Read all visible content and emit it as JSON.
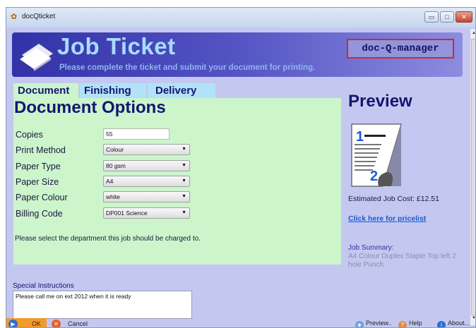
{
  "window": {
    "title": "docQticket",
    "controls": {
      "minimize": "▭",
      "maximize": "□",
      "close": "✕"
    }
  },
  "banner": {
    "title": "Job Ticket",
    "subtitle": "Please complete the ticket and submit your document for printing.",
    "brand": "doc-Q-manager"
  },
  "tabs": [
    {
      "label": "Document"
    },
    {
      "label": "Finishing"
    },
    {
      "label": "Delivery"
    }
  ],
  "form": {
    "title": "Document Options",
    "copies": {
      "label": "Copies",
      "value": "55"
    },
    "print_method": {
      "label": "Print Method",
      "value": "Colour"
    },
    "paper_type": {
      "label": "Paper Type",
      "value": "80 gsm"
    },
    "paper_size": {
      "label": "Paper Size",
      "value": "A4"
    },
    "paper_colour": {
      "label": "Paper Colour",
      "value": "white"
    },
    "billing_code": {
      "label": "Billing Code",
      "value": "DP001 Science"
    },
    "hint": "Please select the department this job should be charged to."
  },
  "preview": {
    "title": "Preview",
    "cost": "Estimated Job Cost: £12.51",
    "pricelist_link": "Click here for pricelist",
    "summary_label": "Job Summary:",
    "summary_text": "A4 Colour Duplex Staple Top left 2 hole Punch"
  },
  "special": {
    "label": "Special Instructions",
    "value": "Please call me on  ext 2012 when it is ready"
  },
  "footer": {
    "ok": "OK",
    "cancel": "Cancel",
    "preview": "Preview..",
    "help": "Help",
    "about": "About..."
  },
  "colors": {
    "window_bg": "#c4c8f0",
    "banner": "#3a3ab0",
    "panel_bg": "#ccf5cc",
    "heading": "#151570",
    "brand_border": "#c23030",
    "ok_button": "#f29a2e"
  },
  "icons": {
    "app": "app-icon",
    "banner": "paper-stack-icon",
    "preview": "document-preview-icon",
    "ok": "play-arrow-icon",
    "cancel": "cancel-x-icon",
    "preview_btn": "preview-icon",
    "help": "help-icon",
    "about": "info-icon"
  }
}
